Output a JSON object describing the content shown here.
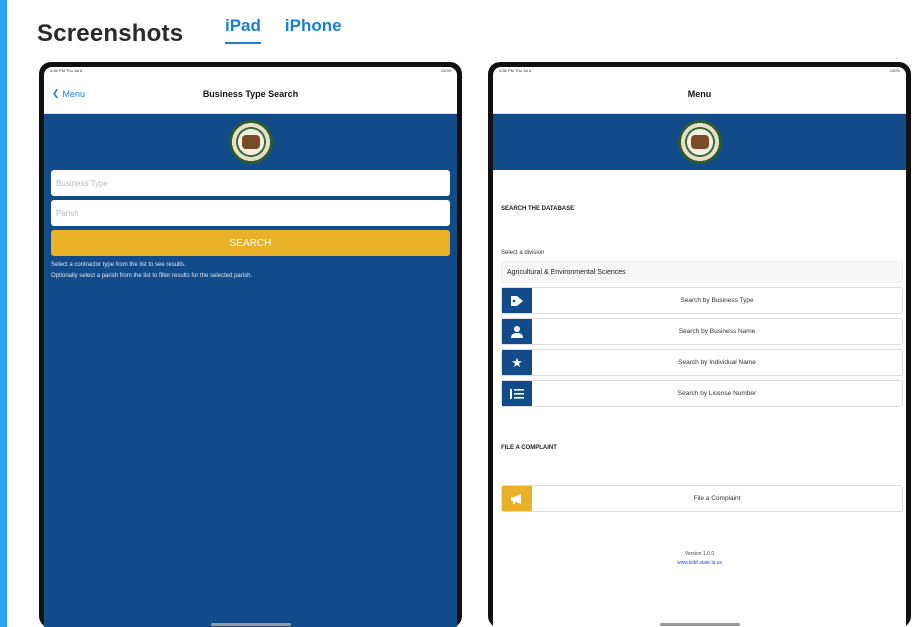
{
  "header": {
    "title": "Screenshots",
    "tabs": [
      {
        "label": "iPad",
        "active": true
      },
      {
        "label": "iPhone",
        "active": false
      }
    ]
  },
  "left_device": {
    "status_time": "4:56 PM  Thu Jul 8",
    "status_battery": "100%",
    "back_label": "Menu",
    "nav_title": "Business Type Search",
    "business_type_placeholder": "Business Type",
    "parish_placeholder": "Parish",
    "search_label": "SEARCH",
    "hint_line_1": "Select a contractor type from the list to see results.",
    "hint_line_2": "Optionally select a parish from the list to filter results for the selected parish."
  },
  "right_device": {
    "status_time": "4:56 PM  Thu Jul 8",
    "status_battery": "100%",
    "nav_title": "Menu",
    "search_section": "SEARCH THE DATABASE",
    "division_label": "Select a division",
    "division_value": "Agricultural & Environmental Sciences",
    "menu_items": [
      {
        "label": "Search by Business Type",
        "icon": "tag-icon"
      },
      {
        "label": "Search by Business Name",
        "icon": "person-icon"
      },
      {
        "label": "Search by Individual Name",
        "icon": "star-icon"
      },
      {
        "label": "Search by License Number",
        "icon": "list-icon"
      }
    ],
    "complaint_section": "FILE A COMPLAINT",
    "complaint_label": "File a Complaint",
    "version": "Version 1.0.0",
    "website": "www.lslbf.state.la.us"
  },
  "colors": {
    "brand_blue": "#124b8a",
    "accent_yellow": "#e8b127",
    "link_blue": "#1a7fd4"
  }
}
